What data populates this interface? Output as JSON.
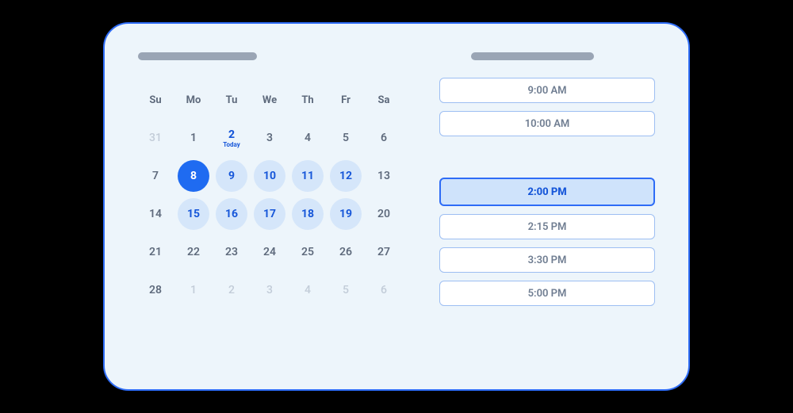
{
  "calendar": {
    "days_of_week": [
      "Su",
      "Mo",
      "Tu",
      "We",
      "Th",
      "Fr",
      "Sa"
    ],
    "today_label": "Today",
    "cells": [
      {
        "n": "31",
        "kind": "other"
      },
      {
        "n": "1",
        "kind": "normal"
      },
      {
        "n": "2",
        "kind": "today"
      },
      {
        "n": "3",
        "kind": "normal"
      },
      {
        "n": "4",
        "kind": "normal"
      },
      {
        "n": "5",
        "kind": "normal"
      },
      {
        "n": "6",
        "kind": "normal"
      },
      {
        "n": "7",
        "kind": "normal"
      },
      {
        "n": "8",
        "kind": "selected"
      },
      {
        "n": "9",
        "kind": "available"
      },
      {
        "n": "10",
        "kind": "available"
      },
      {
        "n": "11",
        "kind": "available"
      },
      {
        "n": "12",
        "kind": "available"
      },
      {
        "n": "13",
        "kind": "normal"
      },
      {
        "n": "14",
        "kind": "normal"
      },
      {
        "n": "15",
        "kind": "available"
      },
      {
        "n": "16",
        "kind": "available"
      },
      {
        "n": "17",
        "kind": "available"
      },
      {
        "n": "18",
        "kind": "available"
      },
      {
        "n": "19",
        "kind": "available"
      },
      {
        "n": "20",
        "kind": "normal"
      },
      {
        "n": "21",
        "kind": "normal"
      },
      {
        "n": "22",
        "kind": "normal"
      },
      {
        "n": "23",
        "kind": "normal"
      },
      {
        "n": "24",
        "kind": "normal"
      },
      {
        "n": "25",
        "kind": "normal"
      },
      {
        "n": "26",
        "kind": "normal"
      },
      {
        "n": "27",
        "kind": "normal"
      },
      {
        "n": "28",
        "kind": "normal"
      },
      {
        "n": "1",
        "kind": "other"
      },
      {
        "n": "2",
        "kind": "other"
      },
      {
        "n": "3",
        "kind": "other"
      },
      {
        "n": "4",
        "kind": "other"
      },
      {
        "n": "5",
        "kind": "other"
      },
      {
        "n": "6",
        "kind": "other"
      }
    ]
  },
  "slots": {
    "group1": [
      "9:00 AM",
      "10:00 AM"
    ],
    "group2": [
      {
        "label": "2:00 PM",
        "selected": true
      },
      {
        "label": "2:15 PM",
        "selected": false
      },
      {
        "label": "3:30 PM",
        "selected": false
      },
      {
        "label": "5:00 PM",
        "selected": false
      }
    ]
  },
  "colors": {
    "accent": "#2e6cf6",
    "panel": "#edf5fb",
    "available": "#d5e6fa",
    "selected_slot": "#cfe3fb"
  }
}
